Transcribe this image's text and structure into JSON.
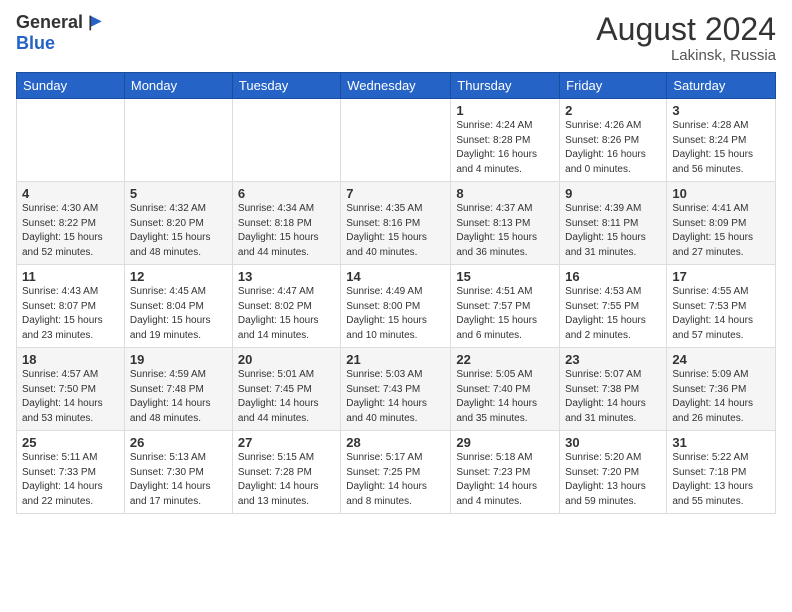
{
  "header": {
    "logo_general": "General",
    "logo_blue": "Blue",
    "month_title": "August 2024",
    "location": "Lakinsk, Russia"
  },
  "weekdays": [
    "Sunday",
    "Monday",
    "Tuesday",
    "Wednesday",
    "Thursday",
    "Friday",
    "Saturday"
  ],
  "weeks": [
    [
      {
        "day": "",
        "info": ""
      },
      {
        "day": "",
        "info": ""
      },
      {
        "day": "",
        "info": ""
      },
      {
        "day": "",
        "info": ""
      },
      {
        "day": "1",
        "info": "Sunrise: 4:24 AM\nSunset: 8:28 PM\nDaylight: 16 hours\nand 4 minutes."
      },
      {
        "day": "2",
        "info": "Sunrise: 4:26 AM\nSunset: 8:26 PM\nDaylight: 16 hours\nand 0 minutes."
      },
      {
        "day": "3",
        "info": "Sunrise: 4:28 AM\nSunset: 8:24 PM\nDaylight: 15 hours\nand 56 minutes."
      }
    ],
    [
      {
        "day": "4",
        "info": "Sunrise: 4:30 AM\nSunset: 8:22 PM\nDaylight: 15 hours\nand 52 minutes."
      },
      {
        "day": "5",
        "info": "Sunrise: 4:32 AM\nSunset: 8:20 PM\nDaylight: 15 hours\nand 48 minutes."
      },
      {
        "day": "6",
        "info": "Sunrise: 4:34 AM\nSunset: 8:18 PM\nDaylight: 15 hours\nand 44 minutes."
      },
      {
        "day": "7",
        "info": "Sunrise: 4:35 AM\nSunset: 8:16 PM\nDaylight: 15 hours\nand 40 minutes."
      },
      {
        "day": "8",
        "info": "Sunrise: 4:37 AM\nSunset: 8:13 PM\nDaylight: 15 hours\nand 36 minutes."
      },
      {
        "day": "9",
        "info": "Sunrise: 4:39 AM\nSunset: 8:11 PM\nDaylight: 15 hours\nand 31 minutes."
      },
      {
        "day": "10",
        "info": "Sunrise: 4:41 AM\nSunset: 8:09 PM\nDaylight: 15 hours\nand 27 minutes."
      }
    ],
    [
      {
        "day": "11",
        "info": "Sunrise: 4:43 AM\nSunset: 8:07 PM\nDaylight: 15 hours\nand 23 minutes."
      },
      {
        "day": "12",
        "info": "Sunrise: 4:45 AM\nSunset: 8:04 PM\nDaylight: 15 hours\nand 19 minutes."
      },
      {
        "day": "13",
        "info": "Sunrise: 4:47 AM\nSunset: 8:02 PM\nDaylight: 15 hours\nand 14 minutes."
      },
      {
        "day": "14",
        "info": "Sunrise: 4:49 AM\nSunset: 8:00 PM\nDaylight: 15 hours\nand 10 minutes."
      },
      {
        "day": "15",
        "info": "Sunrise: 4:51 AM\nSunset: 7:57 PM\nDaylight: 15 hours\nand 6 minutes."
      },
      {
        "day": "16",
        "info": "Sunrise: 4:53 AM\nSunset: 7:55 PM\nDaylight: 15 hours\nand 2 minutes."
      },
      {
        "day": "17",
        "info": "Sunrise: 4:55 AM\nSunset: 7:53 PM\nDaylight: 14 hours\nand 57 minutes."
      }
    ],
    [
      {
        "day": "18",
        "info": "Sunrise: 4:57 AM\nSunset: 7:50 PM\nDaylight: 14 hours\nand 53 minutes."
      },
      {
        "day": "19",
        "info": "Sunrise: 4:59 AM\nSunset: 7:48 PM\nDaylight: 14 hours\nand 48 minutes."
      },
      {
        "day": "20",
        "info": "Sunrise: 5:01 AM\nSunset: 7:45 PM\nDaylight: 14 hours\nand 44 minutes."
      },
      {
        "day": "21",
        "info": "Sunrise: 5:03 AM\nSunset: 7:43 PM\nDaylight: 14 hours\nand 40 minutes."
      },
      {
        "day": "22",
        "info": "Sunrise: 5:05 AM\nSunset: 7:40 PM\nDaylight: 14 hours\nand 35 minutes."
      },
      {
        "day": "23",
        "info": "Sunrise: 5:07 AM\nSunset: 7:38 PM\nDaylight: 14 hours\nand 31 minutes."
      },
      {
        "day": "24",
        "info": "Sunrise: 5:09 AM\nSunset: 7:36 PM\nDaylight: 14 hours\nand 26 minutes."
      }
    ],
    [
      {
        "day": "25",
        "info": "Sunrise: 5:11 AM\nSunset: 7:33 PM\nDaylight: 14 hours\nand 22 minutes."
      },
      {
        "day": "26",
        "info": "Sunrise: 5:13 AM\nSunset: 7:30 PM\nDaylight: 14 hours\nand 17 minutes."
      },
      {
        "day": "27",
        "info": "Sunrise: 5:15 AM\nSunset: 7:28 PM\nDaylight: 14 hours\nand 13 minutes."
      },
      {
        "day": "28",
        "info": "Sunrise: 5:17 AM\nSunset: 7:25 PM\nDaylight: 14 hours\nand 8 minutes."
      },
      {
        "day": "29",
        "info": "Sunrise: 5:18 AM\nSunset: 7:23 PM\nDaylight: 14 hours\nand 4 minutes."
      },
      {
        "day": "30",
        "info": "Sunrise: 5:20 AM\nSunset: 7:20 PM\nDaylight: 13 hours\nand 59 minutes."
      },
      {
        "day": "31",
        "info": "Sunrise: 5:22 AM\nSunset: 7:18 PM\nDaylight: 13 hours\nand 55 minutes."
      }
    ]
  ]
}
